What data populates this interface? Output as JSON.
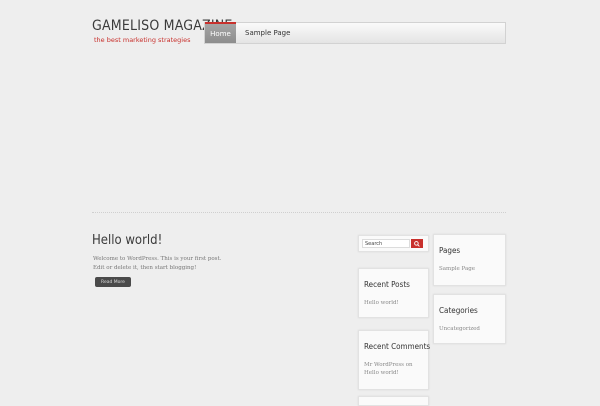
{
  "header": {
    "site_title": "GAMELISO MAGAZINE",
    "tagline": "the best marketing strategies"
  },
  "nav": {
    "items": [
      {
        "label": "Home",
        "active": true
      },
      {
        "label": "Sample Page",
        "active": false
      }
    ]
  },
  "post": {
    "title": "Hello world!",
    "excerpt": "Welcome to WordPress. This is your first post. Edit or delete it, then start blogging!",
    "read_more": "Read More"
  },
  "search": {
    "value": "Search",
    "button_icon": "search-icon"
  },
  "widgets": {
    "recent_posts": {
      "title": "Recent Posts",
      "items": [
        "Hello world!"
      ]
    },
    "recent_comments": {
      "title": "Recent Comments",
      "text": "Mr WordPress on Hello world!"
    },
    "pages": {
      "title": "Pages",
      "items": [
        "Sample Page"
      ]
    },
    "categories": {
      "title": "Categories",
      "items": [
        "Uncategorized"
      ]
    }
  },
  "colors": {
    "accent": "#c8302c",
    "background": "#eeeeee"
  }
}
